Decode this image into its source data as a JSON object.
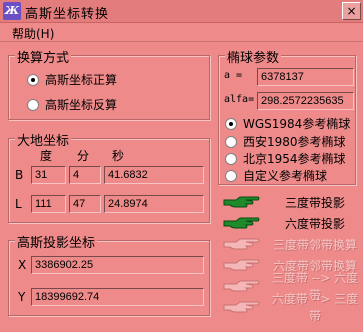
{
  "window": {
    "title": "高斯坐标转换",
    "icon": "app-logo-icon",
    "close_glyph": "×"
  },
  "menu": {
    "help": "帮助(H)"
  },
  "calc_method": {
    "title": "换算方式",
    "options": [
      {
        "label": "高斯坐标正算",
        "selected": true
      },
      {
        "label": "高斯坐标反算",
        "selected": false
      }
    ]
  },
  "geo": {
    "title": "大地坐标",
    "headers": {
      "deg": "度",
      "min": "分",
      "sec": "秒"
    },
    "b_label": "B",
    "l_label": "L",
    "b": {
      "deg": "31",
      "min": "4",
      "sec": "41.6832"
    },
    "l": {
      "deg": "111",
      "min": "47",
      "sec": "24.8974"
    }
  },
  "gauss": {
    "title": "高斯投影坐标",
    "x_label": "X",
    "y_label": "Y",
    "x": "3386902.25",
    "y": "18399692.74"
  },
  "ellipsoid": {
    "title": "椭球参数",
    "a_label": "a   =",
    "alfa_label": "alfa=",
    "a": "6378137",
    "alfa": "298.2572235635",
    "options": [
      {
        "label": "WGS1984参考椭球",
        "selected": true
      },
      {
        "label": "西安1980参考椭球",
        "selected": false
      },
      {
        "label": "北京1954参考椭球",
        "selected": false
      },
      {
        "label": "自定义参考椭球",
        "selected": false
      }
    ]
  },
  "actions": [
    {
      "label": "三度带投影",
      "enabled": true
    },
    {
      "label": "六度带投影",
      "enabled": true
    },
    {
      "label": "三度带邻带换算",
      "enabled": false
    },
    {
      "label": "六度带邻带换算",
      "enabled": false
    },
    {
      "label": "三度带 --> 六度带",
      "enabled": false
    },
    {
      "label": "六度带 --> 三度带",
      "enabled": false
    }
  ],
  "colors": {
    "background": "#ee8a8a",
    "hand_enabled": "#1e8a2a",
    "hand_disabled": "#f4b6b6"
  }
}
